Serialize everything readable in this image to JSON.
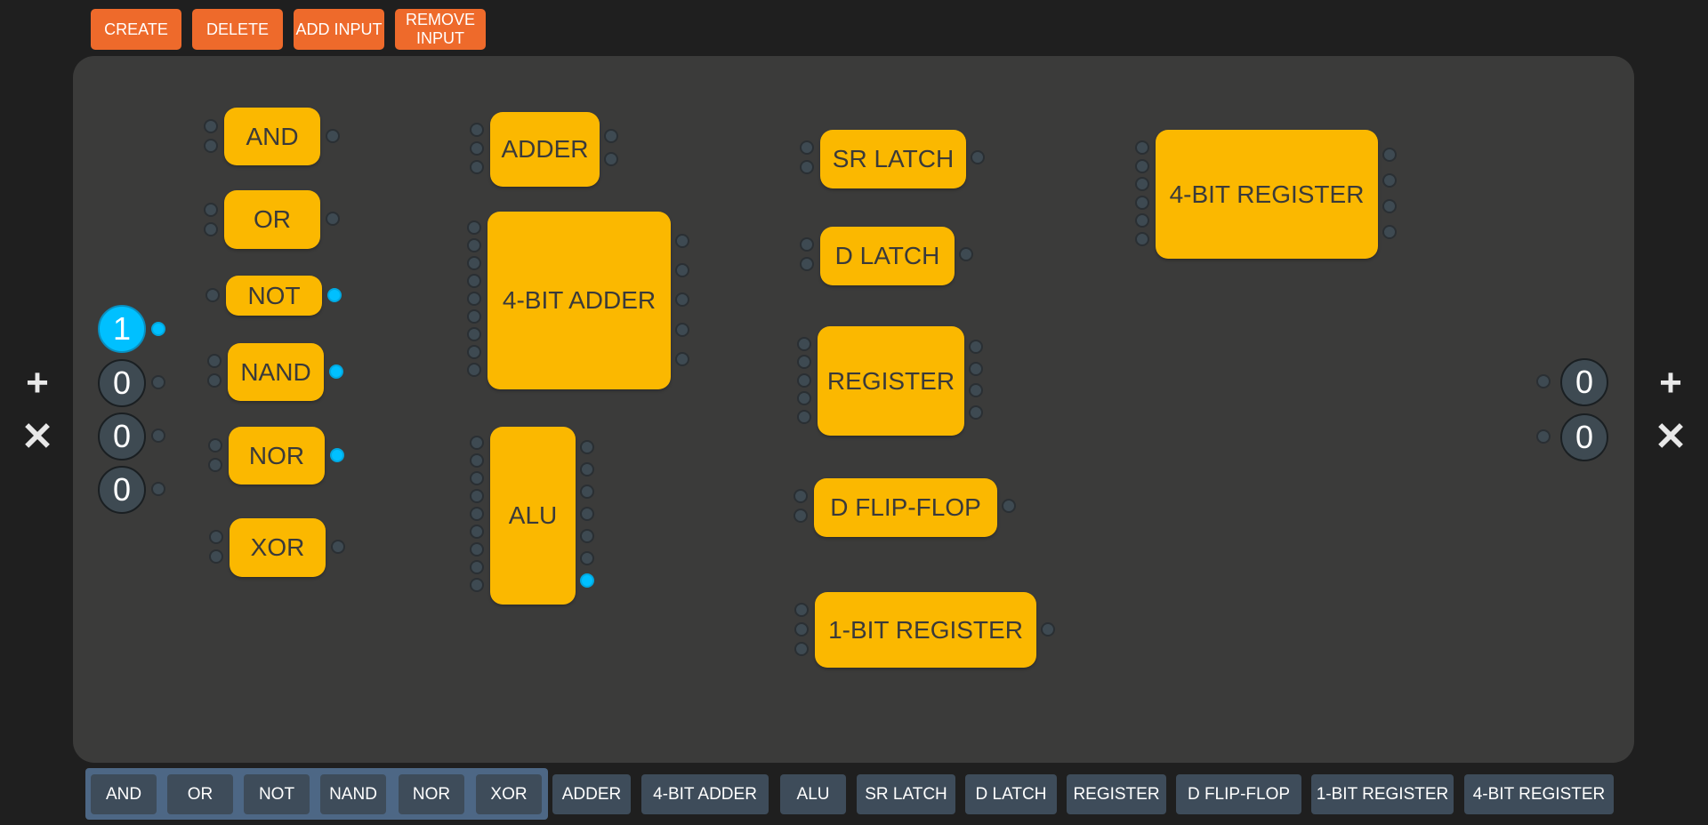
{
  "toolbar": {
    "create": "CREATE",
    "delete": "DELETE",
    "add_input": "ADD INPUT",
    "remove_input": "REMOVE INPUT"
  },
  "inputs": [
    "1",
    "0",
    "0",
    "0"
  ],
  "outputs": [
    "0",
    "0"
  ],
  "side_controls": {
    "add": "+",
    "remove": "✕"
  },
  "gates": {
    "and": "AND",
    "or": "OR",
    "not": "NOT",
    "nand": "NAND",
    "nor": "NOR",
    "xor": "XOR",
    "adder": "ADDER",
    "adder4": "4-BIT ADDER",
    "alu": "ALU",
    "sr_latch": "SR LATCH",
    "d_latch": "D LATCH",
    "register": "REGISTER",
    "d_flipflop": "D FLIP-FLOP",
    "reg1": "1-BIT REGISTER",
    "reg4": "4-BIT REGISTER"
  },
  "palette": [
    "AND",
    "OR",
    "NOT",
    "NAND",
    "NOR",
    "XOR",
    "ADDER",
    "4-BIT ADDER",
    "ALU",
    "SR LATCH",
    "D LATCH",
    "REGISTER",
    "D FLIP-FLOP",
    "1-BIT REGISTER",
    "4-BIT REGISTER"
  ],
  "colors": {
    "button": "#ee6a2b",
    "gate": "#fbb800",
    "active": "#00c0ff",
    "canvas": "#3b3b3a",
    "palette": "#3e4c5a",
    "palette_group": "#4d6785"
  }
}
